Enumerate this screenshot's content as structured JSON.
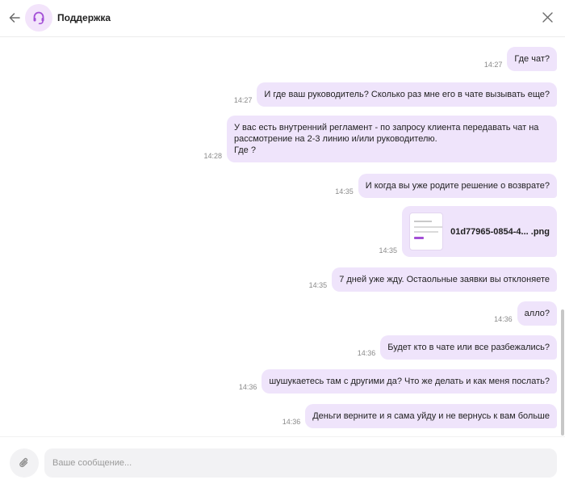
{
  "header": {
    "title": "Поддержка",
    "back_icon": "arrow-left-icon",
    "avatar_icon": "headset-icon",
    "close_icon": "close-icon",
    "accent_color": "#a34fd6"
  },
  "messages": [
    {
      "time": "14:27",
      "text": "Где чат?"
    },
    {
      "time": "14:27",
      "text": "И где ваш руководитель? Сколько раз мне его в чате вызывать еще?"
    },
    {
      "time": "14:28",
      "text": "У вас есть внутренний регламент - по запросу клиента передавать чат на рассмотрение на 2-3 линию и/или руководителю.\nГде ?"
    },
    {
      "time": "14:35",
      "text": "И когда вы уже родите решение о возврате?"
    },
    {
      "time": "14:35",
      "file_name": "01d77965-0854-4... .png"
    },
    {
      "time": "14:35",
      "text": "7 дней уже жду. Остаольные заявки вы отклоняете"
    },
    {
      "time": "14:36",
      "text": "алло?"
    },
    {
      "time": "14:36",
      "text": "Будет кто в чате или все разбежались?"
    },
    {
      "time": "14:36",
      "text": "шушукаетесь там с другими да? Что же делать и как меня послать?"
    },
    {
      "time": "14:36",
      "text": "Деньги верните и я сама уйду и не вернусь к вам больше"
    }
  ],
  "composer": {
    "placeholder": "Ваше сообщение...",
    "value": "",
    "attach_icon": "paperclip-icon"
  },
  "colors": {
    "bubble": "#efe4fb",
    "avatar_bg": "#f3e4fb"
  }
}
